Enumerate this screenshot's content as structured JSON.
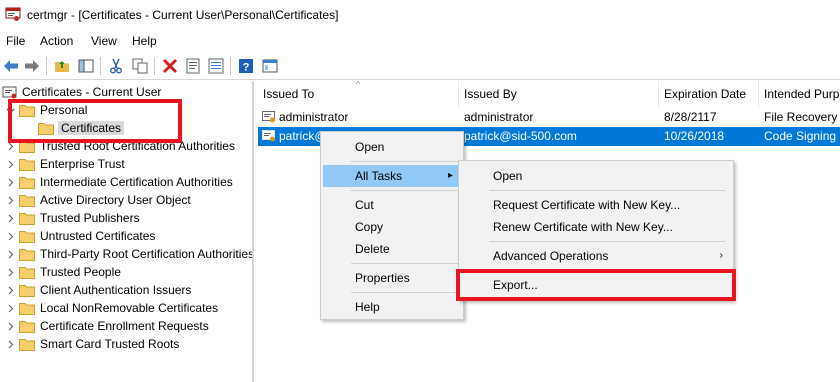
{
  "window": {
    "title": "certmgr - [Certificates - Current User\\Personal\\Certificates]"
  },
  "menu": [
    "File",
    "Action",
    "View",
    "Help"
  ],
  "toolbar": {
    "icons": [
      "back-arrow-icon",
      "forward-arrow-icon",
      "up-folder-icon",
      "show-hide-tree-icon",
      "cut-icon",
      "copy-icon",
      "delete-icon",
      "properties-icon",
      "export-list-icon",
      "help-icon",
      "console-icon"
    ]
  },
  "tree": {
    "root": "Certificates - Current User",
    "personal": "Personal",
    "certificates": "Certificates",
    "stores": [
      "Trusted Root Certification Authorities",
      "Enterprise Trust",
      "Intermediate Certification Authorities",
      "Active Directory User Object",
      "Trusted Publishers",
      "Untrusted Certificates",
      "Third-Party Root Certification Authorities",
      "Trusted People",
      "Client Authentication Issuers",
      "Local NonRemovable Certificates",
      "Certificate Enrollment Requests",
      "Smart Card Trusted Roots"
    ]
  },
  "list": {
    "columns": [
      "Issued To",
      "Issued By",
      "Expiration Date",
      "Intended Purp"
    ],
    "rows": [
      {
        "issued_to": "administrator",
        "issued_by": "administrator",
        "expiration": "8/28/2117",
        "purpose": "File Recovery"
      },
      {
        "issued_to": "patrick@sid-500",
        "issued_by": "patrick@sid-500.com",
        "expiration": "10/26/2018",
        "purpose": "Code Signing"
      }
    ]
  },
  "context_menu": {
    "open": "Open",
    "all_tasks": "All Tasks",
    "cut": "Cut",
    "copy": "Copy",
    "delete": "Delete",
    "properties": "Properties",
    "help": "Help"
  },
  "submenu": {
    "open": "Open",
    "request_new_key": "Request Certificate with New Key...",
    "renew_new_key": "Renew Certificate with New Key...",
    "advanced": "Advanced Operations",
    "export": "Export..."
  },
  "colors": {
    "selection": "#0078d7",
    "menu_highlight": "#91c9f7",
    "annotation_red": "#e8141f",
    "folder": "#f5cf6b"
  }
}
